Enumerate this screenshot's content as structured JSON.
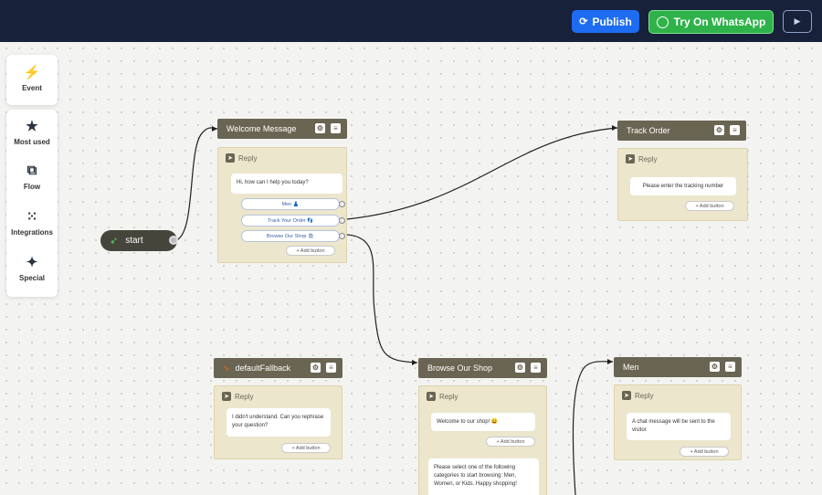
{
  "topbar": {
    "publish_label": "Publish",
    "whatsapp_label": "Try On WhatsApp"
  },
  "toolbar": {
    "event": "Event",
    "most_used": "Most used",
    "flow": "Flow",
    "integrations": "Integrations",
    "special": "Special"
  },
  "start": {
    "label": "start"
  },
  "nodes": {
    "welcome": {
      "title": "Welcome Message",
      "reply": "Reply",
      "message": "Hi, how can I help you today?",
      "buttons": [
        "Men 👗",
        "Track Your Order 👣",
        "Browse Our Shop 🛍"
      ],
      "add_button": "+ Add button"
    },
    "track": {
      "title": "Track Order",
      "reply": "Reply",
      "message": "Please enter the tracking number",
      "add_button": "+ Add button"
    },
    "fallback": {
      "title": "defaultFallback",
      "reply": "Reply",
      "message": "I didn't understand. Can you rephrase your question?",
      "add_button": "+ Add button"
    },
    "browse": {
      "title": "Browse Our Shop",
      "reply": "Reply",
      "message": "Welcome to our shop! 😀",
      "add_button": "+ Add button",
      "message2": "Please select one of the following categories to start browsing: Men, Women, or Kids. Happy shopping!"
    },
    "men": {
      "title": "Men",
      "reply": "Reply",
      "message": "A chat message will be sent to the visitor",
      "add_button": "+ Add button"
    }
  }
}
